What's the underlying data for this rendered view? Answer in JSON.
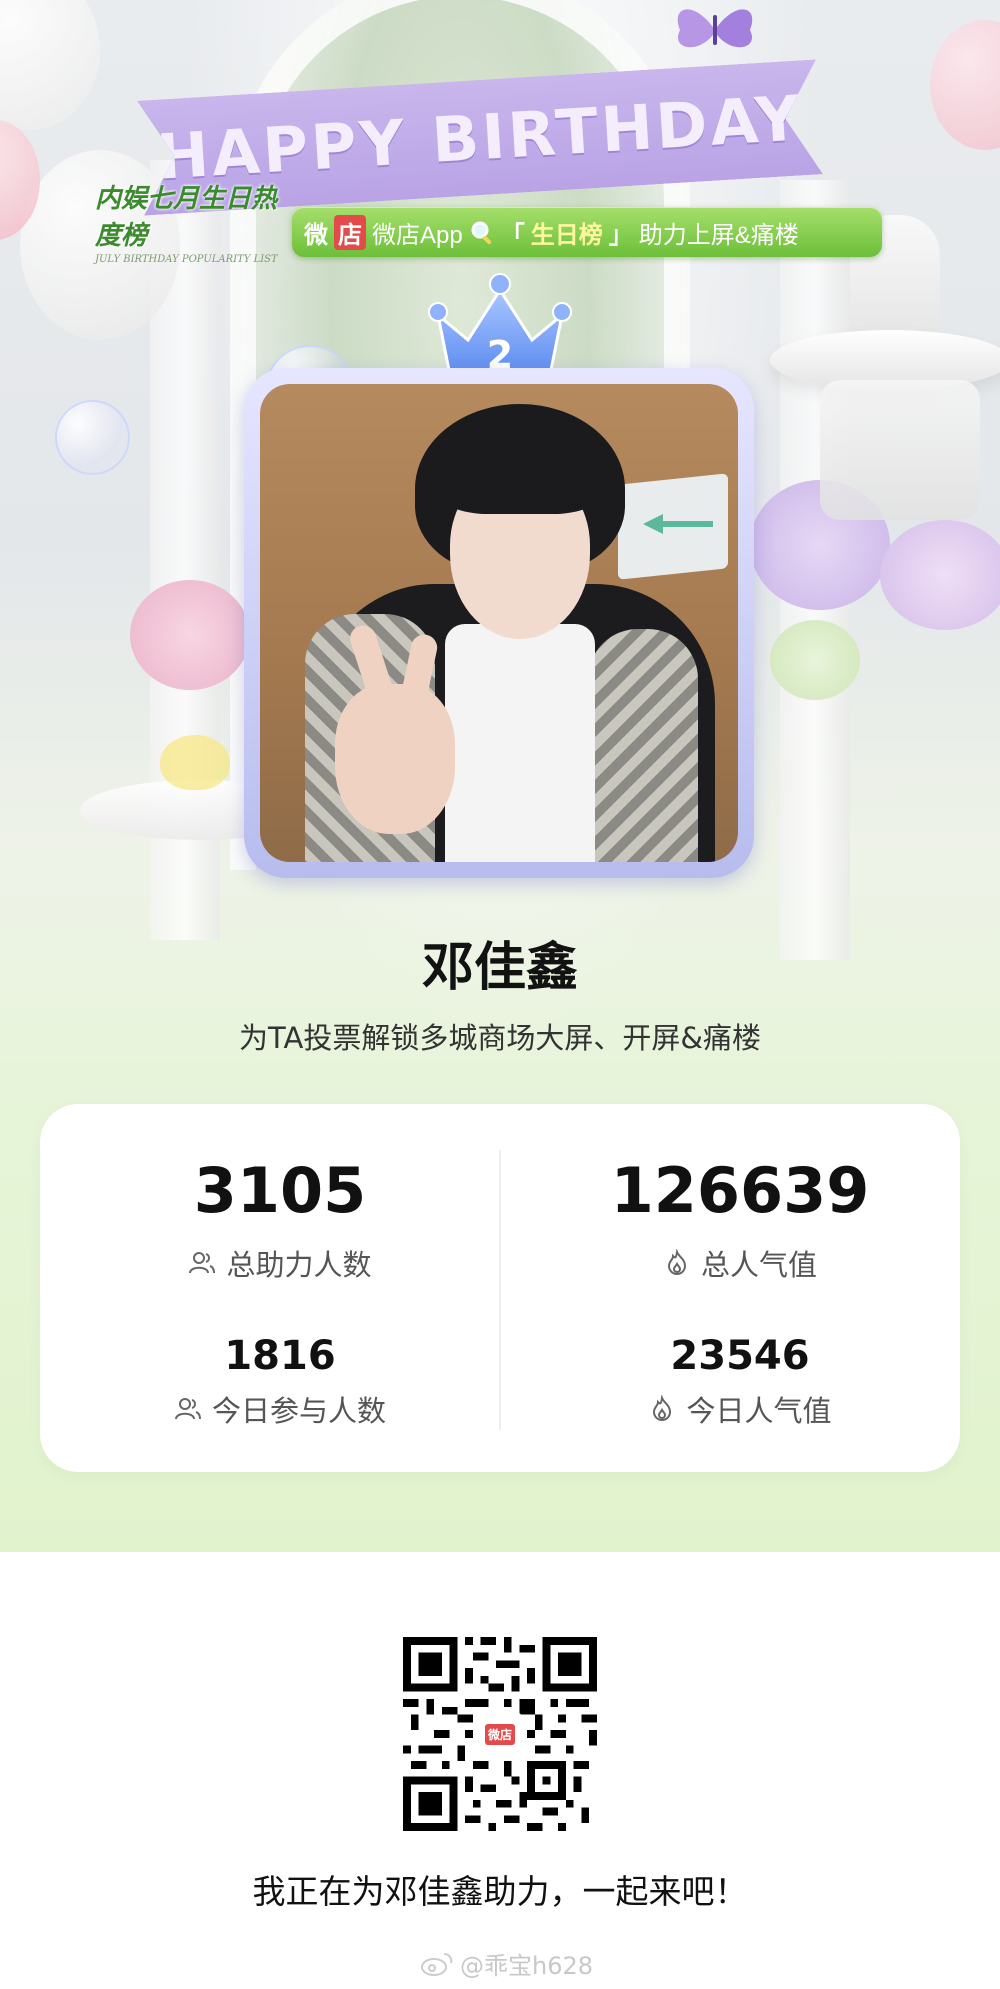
{
  "header": {
    "banner_text": "HAPPY BIRTHDAY",
    "logo_text": "内娱七月生日热度榜",
    "logo_subtext": "JULY BIRTHDAY POPULARITY LIST",
    "promo": {
      "brand_a": "微",
      "brand_b": "店",
      "app_text": "微店App",
      "bracket_open": "「",
      "highlight": "生日榜",
      "bracket_close": "」",
      "suffix": "助力上屏&痛楼"
    },
    "rank": "2"
  },
  "profile": {
    "name": "邓佳鑫",
    "subtitle": "为TA投票解锁多城商场大屏、开屏&痛楼"
  },
  "stats": {
    "total_helpers": {
      "value": "3105",
      "label": "总助力人数"
    },
    "total_popularity": {
      "value": "126639",
      "label": "总人气值"
    },
    "today_participants": {
      "value": "1816",
      "label": "今日参与人数"
    },
    "today_popularity": {
      "value": "23546",
      "label": "今日人气值"
    }
  },
  "footer": {
    "qr_badge": "微店",
    "cta": "我正在为邓佳鑫助力，一起来吧！",
    "watermark": "@乖宝h628"
  },
  "colors": {
    "pill_green": "#7cc84a",
    "banner_purple": "#bda8e8",
    "crown_blue": "#7fa6f2",
    "brand_red": "#e34b4b"
  },
  "icons": [
    "butterfly-icon",
    "search-icon",
    "crown-icon",
    "people-icon",
    "flame-icon",
    "weibo-icon"
  ]
}
